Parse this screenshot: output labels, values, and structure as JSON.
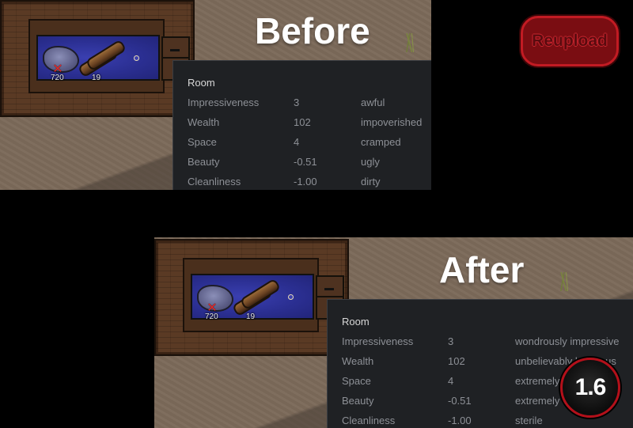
{
  "labels": {
    "before": "Before",
    "after": "After"
  },
  "badges": {
    "reupload": "Reupload",
    "version": "1.6"
  },
  "items": {
    "steel_count": "720",
    "wood_count": "19"
  },
  "before_panel": {
    "title": "Room",
    "rows": [
      {
        "stat": "Impressiveness",
        "value": "3",
        "desc": "awful"
      },
      {
        "stat": "Wealth",
        "value": "102",
        "desc": "impoverished"
      },
      {
        "stat": "Space",
        "value": "4",
        "desc": "cramped"
      },
      {
        "stat": "Beauty",
        "value": "-0.51",
        "desc": "ugly"
      },
      {
        "stat": "Cleanliness",
        "value": "-1.00",
        "desc": "dirty"
      }
    ]
  },
  "after_panel": {
    "title": "Room",
    "rows": [
      {
        "stat": "Impressiveness",
        "value": "3",
        "desc": "wondrously impressive"
      },
      {
        "stat": "Wealth",
        "value": "102",
        "desc": "unbelievably luxurious"
      },
      {
        "stat": "Space",
        "value": "4",
        "desc": "extremely spacious"
      },
      {
        "stat": "Beauty",
        "value": "-0.51",
        "desc": "extremely beautiful"
      },
      {
        "stat": "Cleanliness",
        "value": "-1.00",
        "desc": "sterile"
      }
    ]
  },
  "colors": {
    "reupload_red": "#c21b23",
    "panel_bg": "#1f2124",
    "zone_blue": "#2b2f92"
  }
}
